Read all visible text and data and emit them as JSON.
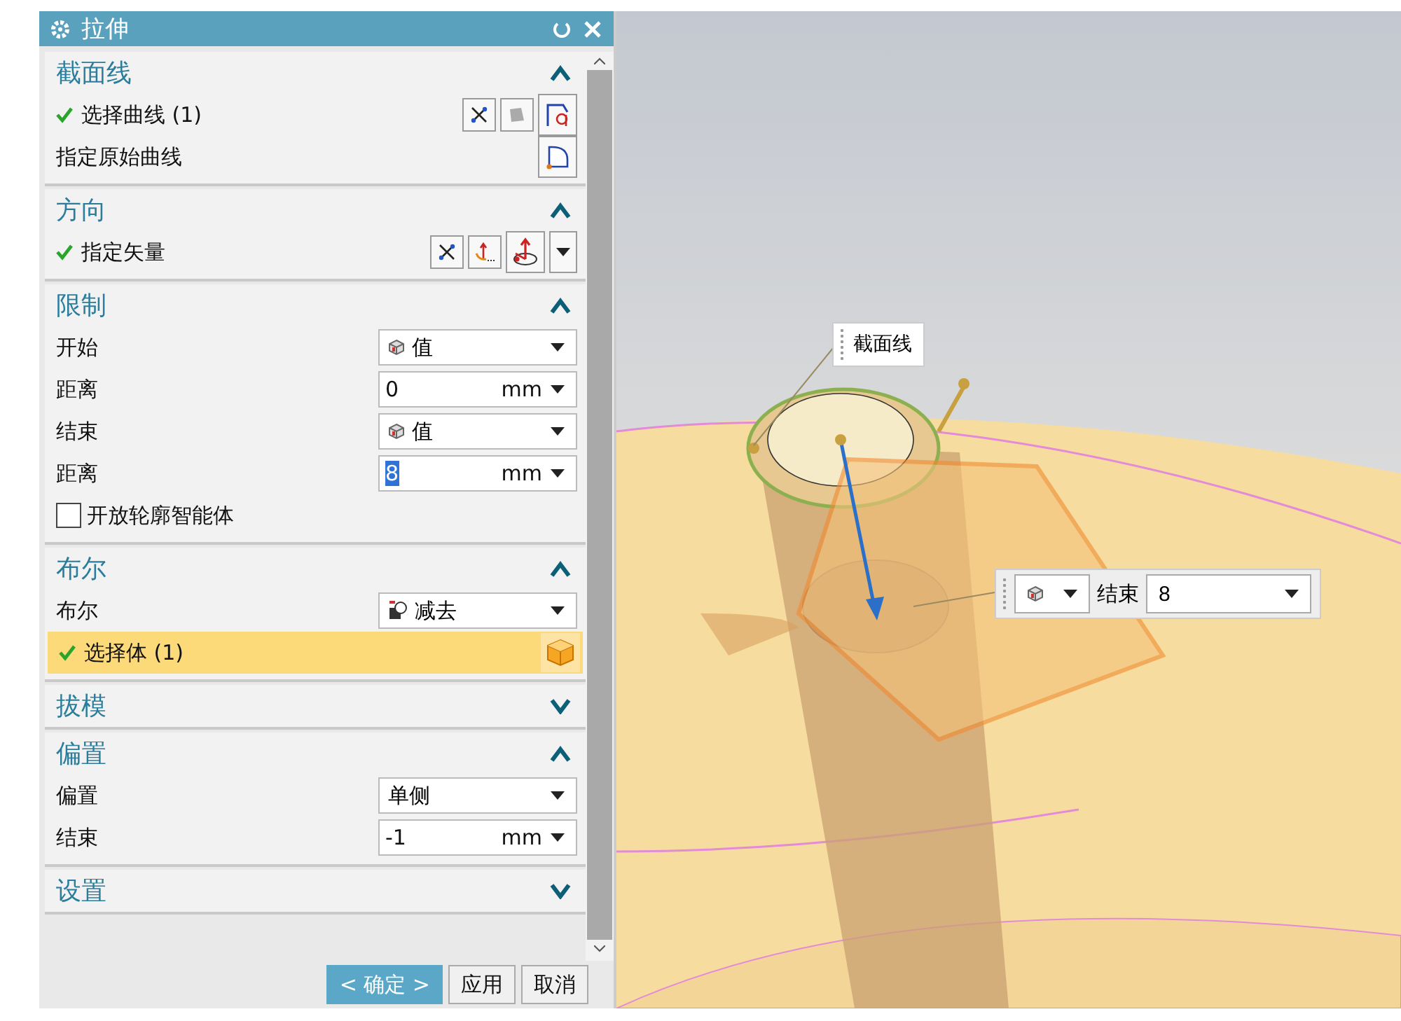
{
  "dialog": {
    "title": "拉伸"
  },
  "sections": [
    {
      "title": "截面线",
      "expanded": true,
      "rows": [
        {
          "kind": "curve-select",
          "label": "选择曲线 (1)",
          "done": true,
          "highlighted": false
        },
        {
          "kind": "curve-pick",
          "label": "指定原始曲线"
        }
      ]
    },
    {
      "title": "方向",
      "expanded": true,
      "rows": [
        {
          "kind": "vector-select",
          "label": "指定矢量",
          "done": true,
          "highlighted": false
        }
      ]
    },
    {
      "title": "限制",
      "expanded": true,
      "rows": [
        {
          "kind": "value-dropdown",
          "label": "开始",
          "value": "值"
        },
        {
          "kind": "number",
          "label": "距离",
          "value": "0",
          "unit": "mm",
          "value_selected": false
        },
        {
          "kind": "value-dropdown",
          "label": "结束",
          "value": "值"
        },
        {
          "kind": "number",
          "label": "距离",
          "value": "8",
          "unit": "mm",
          "value_selected": true
        },
        {
          "kind": "checkbox",
          "label": "开放轮廓智能体",
          "checked": false
        }
      ]
    },
    {
      "title": "布尔",
      "expanded": true,
      "rows": [
        {
          "kind": "boolean-dropdown",
          "label": "布尔",
          "value": "减去"
        },
        {
          "kind": "body-select",
          "label": "选择体 (1)",
          "done": true,
          "highlighted": true
        }
      ]
    },
    {
      "title": "拔模",
      "expanded": false
    },
    {
      "title": "偏置",
      "expanded": true,
      "rows": [
        {
          "kind": "dropdown",
          "label": "偏置",
          "value": "单侧"
        },
        {
          "kind": "number",
          "label": "结束",
          "value": "-1",
          "unit": "mm",
          "value_selected": false
        }
      ]
    },
    {
      "title": "设置",
      "expanded": false
    }
  ],
  "buttons": [
    {
      "label": "< 确定 >",
      "primary": true
    },
    {
      "label": "应用",
      "primary": false
    },
    {
      "label": "取消",
      "primary": false
    }
  ],
  "viewport": {
    "section_label": "截面线",
    "handle": {
      "label": "结束",
      "value": "8"
    }
  }
}
